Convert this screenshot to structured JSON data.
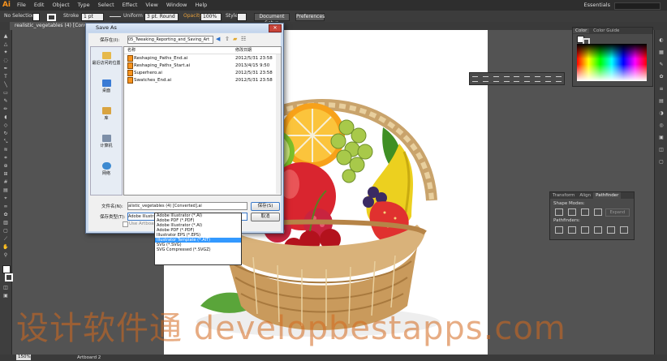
{
  "app": {
    "logo": "Ai",
    "menus": [
      "File",
      "Edit",
      "Object",
      "Type",
      "Select",
      "Effect",
      "View",
      "Window",
      "Help"
    ],
    "workspace": "Essentials"
  },
  "control_bar": {
    "selection": "No Selection",
    "stroke_label": "Stroke",
    "stroke_weight": "1 pt",
    "uniform": "Uniform",
    "brush": "3 pt. Round",
    "opacity_label": "Opacity",
    "opacity_value": "100%",
    "style_label": "Style",
    "doc_setup": "Document Setup",
    "preferences": "Preferences"
  },
  "document_tab": "realistic_vegetables (4) [Converted]...",
  "status_bar": {
    "zoom": "150%",
    "artboard": "Artboard 2"
  },
  "color_panel": {
    "tabs": [
      "Color",
      "Color Guide"
    ]
  },
  "pathfinder_panel": {
    "tabs": [
      "Transform",
      "Align",
      "Pathfinder"
    ],
    "shape_modes": "Shape Modes:",
    "expand": "Expand",
    "pathfinders": "Pathfinders:"
  },
  "dialog": {
    "title": "Save As",
    "save_in_label": "保存在(I):",
    "save_in_value": "05_Tweaking_Reporting_and_Saving_Art",
    "places": [
      "最近访问的位置",
      "桌面",
      "库",
      "计算机",
      "网络"
    ],
    "columns": [
      "名称",
      "修改日期"
    ],
    "files": [
      {
        "name": "Reshaping_Paths_End.ai",
        "date": "2012/5/31 23:58"
      },
      {
        "name": "Reshaping_Paths_Start.ai",
        "date": "2013/4/15 9:50"
      },
      {
        "name": "Superhero.ai",
        "date": "2012/5/31 23:58"
      },
      {
        "name": "Swatches_End.ai",
        "date": "2012/5/31 23:58"
      }
    ],
    "filename_label": "文件名(N):",
    "filename_value": "alistic_vegetables (4) [Converted].ai",
    "filetype_label": "保存类型(T):",
    "filetype_value": "Adobe Illustrator (*.AI)",
    "save_button": "保存(S)",
    "cancel_button": "取消",
    "use_artboards": "Use Artboards",
    "filetype_options": [
      "Adobe Illustrator (*.AI)",
      "Adobe PDF (*.PDF)",
      "Adobe Illustrator (*.AI)",
      "Adobe PDF (*.PDF)",
      "Illustrator EPS (*.EPS)",
      "Illustrator Template (*.AIT)",
      "SVG (*.SVG)",
      "SVG Compressed (*.SVGZ)"
    ],
    "selected_option_index": 5
  },
  "watermark": "设计软件通 developbestapps.com"
}
